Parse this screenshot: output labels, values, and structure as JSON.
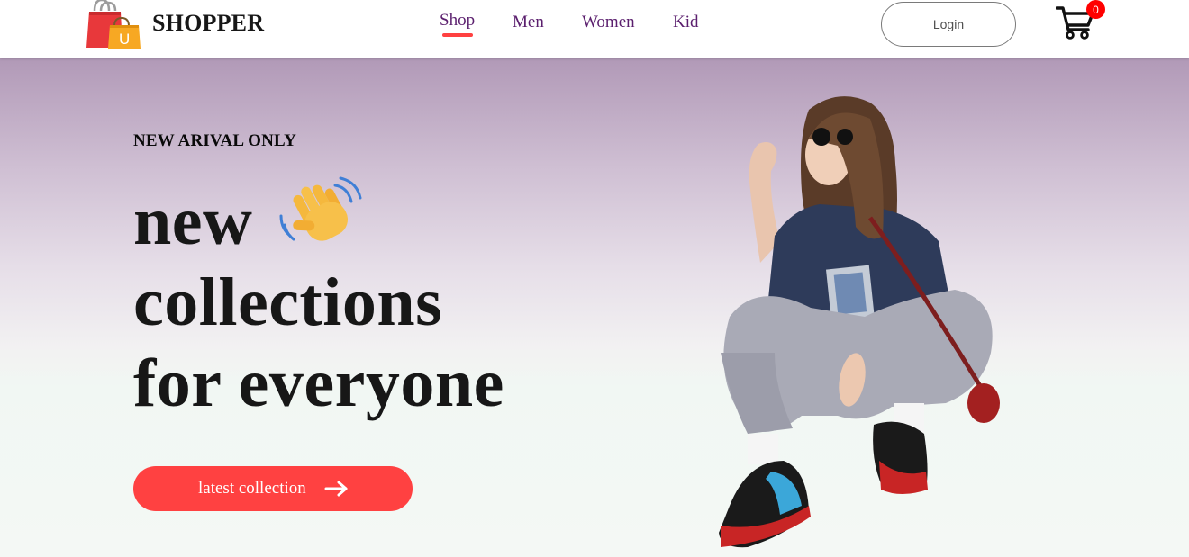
{
  "brand": {
    "name": "SHOPPER",
    "logo_icon": "shopping-bags-icon"
  },
  "nav": {
    "items": [
      {
        "label": "Shop",
        "active": true
      },
      {
        "label": "Men",
        "active": false
      },
      {
        "label": "Women",
        "active": false
      },
      {
        "label": "Kid",
        "active": false
      }
    ]
  },
  "header": {
    "login_label": "Login",
    "cart_count": "0",
    "cart_icon": "cart-icon"
  },
  "hero": {
    "tagline": "NEW ARIVAL ONLY",
    "line1": "new",
    "line2": "collections",
    "line3": "for everyone",
    "hand_icon": "waving-hand-icon",
    "cta_label": "latest collection",
    "cta_icon": "arrow-right-icon",
    "image": "model-in-oversized-tee-and-sneakers-photo"
  },
  "colors": {
    "accent": "#ff4141",
    "nav_text": "#5b1f6e",
    "hero_top": "#b199b7",
    "hero_bottom": "#f4f8f5",
    "text_dark": "#171717"
  }
}
